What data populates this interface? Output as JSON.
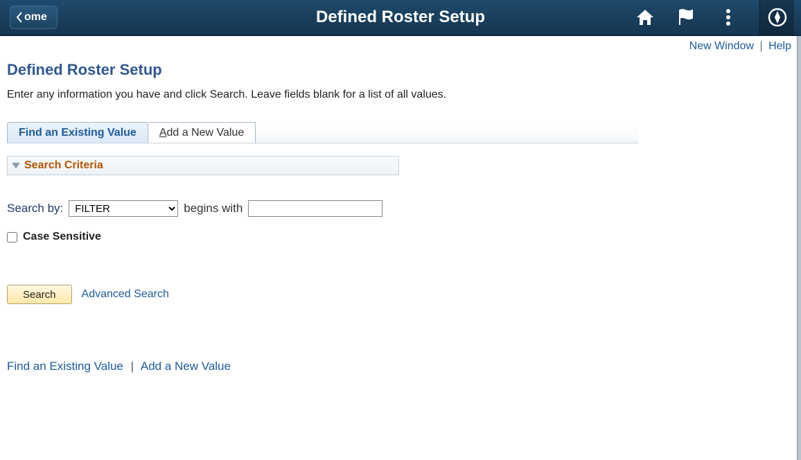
{
  "header": {
    "back_label": "ome",
    "title": "Defined Roster Setup",
    "icons": {
      "home": "home-icon",
      "flag": "flag-icon",
      "more": "more-icon",
      "compass": "compass-icon"
    }
  },
  "top_links": {
    "new_window": "New Window",
    "help": "Help"
  },
  "page": {
    "title": "Defined Roster Setup",
    "instruction": "Enter any information you have and click Search. Leave fields blank for a list of all values."
  },
  "tabs": {
    "find": "Find an Existing Value",
    "add_prefix": "A",
    "add_rest": "dd a New Value"
  },
  "search_criteria": {
    "label": "Search Criteria"
  },
  "form": {
    "search_by_label": "Search by:",
    "filter_selected": "FILTER",
    "operator_label": "begins with",
    "input_value": "",
    "case_sensitive_label": "Case Sensitive",
    "case_sensitive_checked": false
  },
  "actions": {
    "search": "Search",
    "advanced": "Advanced Search"
  },
  "bottom_links": {
    "find": "Find an Existing Value",
    "add": "Add a New Value"
  }
}
